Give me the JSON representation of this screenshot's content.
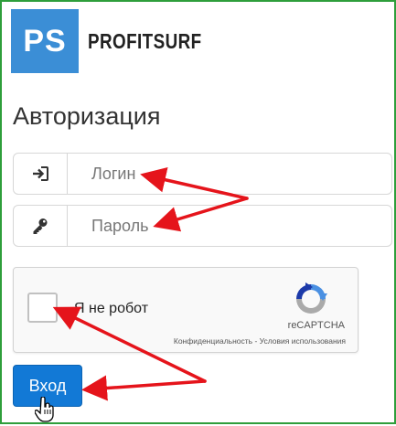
{
  "logo": {
    "mark": "PS",
    "text": "PROFITSURF"
  },
  "page": {
    "title": "Авторизация"
  },
  "form": {
    "login": {
      "placeholder": "Логин",
      "icon": "sign-in-icon"
    },
    "password": {
      "placeholder": "Пароль",
      "icon": "key-icon"
    },
    "submit_label": "Вход"
  },
  "recaptcha": {
    "label": "Я не робот",
    "brand": "reCAPTCHA",
    "links": "Конфиденциальность - Условия использования"
  },
  "colors": {
    "frame": "#2e9e3b",
    "logo_bg": "#3b8ed6",
    "button": "#1279d6",
    "annotation_arrow": "#e5141b"
  }
}
